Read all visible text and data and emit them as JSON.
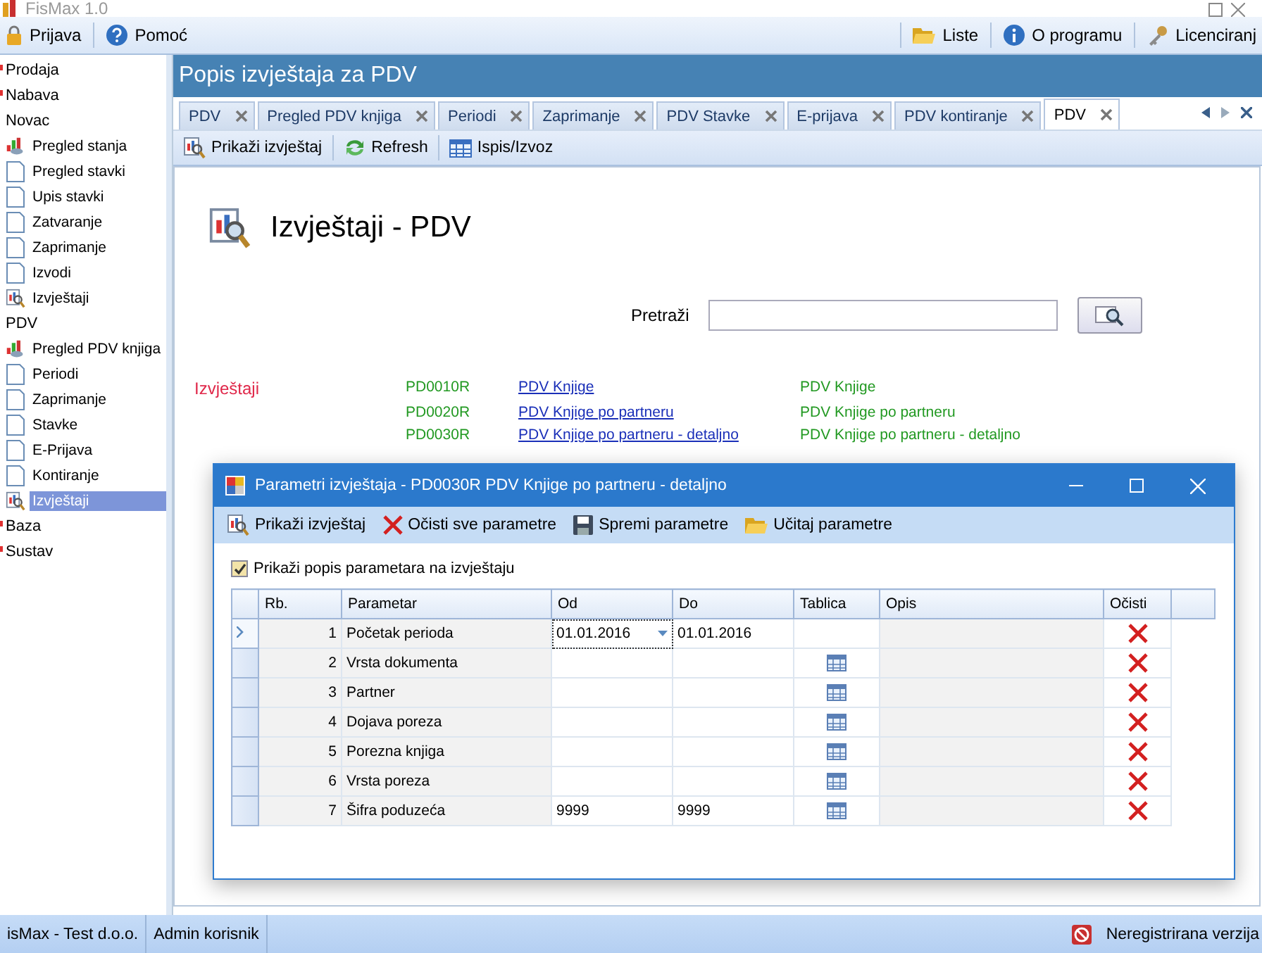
{
  "window": {
    "title": "FisMax 1.0"
  },
  "menubar": {
    "left": [
      {
        "label": "Prijava",
        "kind": "lock"
      },
      {
        "label": "Pomoć",
        "kind": "help"
      }
    ],
    "right": [
      {
        "label": "Liste",
        "kind": "folder"
      },
      {
        "label": "O programu",
        "kind": "info"
      },
      {
        "label": "Licenciranj",
        "kind": "keys"
      }
    ]
  },
  "sidebar": {
    "items": [
      {
        "label": "Prodaja",
        "expanded": false
      },
      {
        "label": "Nabava",
        "expanded": false
      },
      {
        "label": "Novac",
        "expanded": true,
        "children": [
          {
            "label": "Pregled stanja",
            "kind": "chart",
            "selected": false
          },
          {
            "label": "Pregled stavki",
            "kind": "page",
            "selected": false
          },
          {
            "label": "Upis stavki",
            "kind": "page",
            "selected": false
          },
          {
            "label": "Zatvaranje",
            "kind": "page",
            "selected": false
          },
          {
            "label": "Zaprimanje",
            "kind": "page",
            "selected": false
          },
          {
            "label": "Izvodi",
            "kind": "page",
            "selected": false
          },
          {
            "label": "Izvještaji",
            "kind": "report",
            "selected": false
          }
        ]
      },
      {
        "label": "PDV",
        "expanded": true,
        "children": [
          {
            "label": "Pregled PDV knjiga",
            "kind": "chart",
            "selected": false
          },
          {
            "label": "Periodi",
            "kind": "page",
            "selected": false
          },
          {
            "label": "Zaprimanje",
            "kind": "page",
            "selected": false
          },
          {
            "label": "Stavke",
            "kind": "page",
            "selected": false
          },
          {
            "label": "E-Prijava",
            "kind": "page",
            "selected": false
          },
          {
            "label": "Kontiranje",
            "kind": "page",
            "selected": false
          },
          {
            "label": "Izvještaji",
            "kind": "report",
            "selected": true
          }
        ]
      },
      {
        "label": "Baza",
        "expanded": false
      },
      {
        "label": "Sustav",
        "expanded": false
      }
    ]
  },
  "panel": {
    "title": "Popis izvještaja za PDV"
  },
  "tabs": [
    {
      "label": "PDV",
      "selected": false
    },
    {
      "label": "Pregled PDV knjiga",
      "selected": false
    },
    {
      "label": "Periodi",
      "selected": false
    },
    {
      "label": "Zaprimanje",
      "selected": false
    },
    {
      "label": "PDV Stavke",
      "selected": false
    },
    {
      "label": "E-prijava",
      "selected": false
    },
    {
      "label": "PDV kontiranje",
      "selected": false
    },
    {
      "label": "PDV",
      "selected": true
    }
  ],
  "toolbar": [
    {
      "label": "Prikaži izvještaj",
      "kind": "report"
    },
    {
      "label": "Refresh",
      "kind": "refresh"
    },
    {
      "label": "Ispis/Izvoz",
      "kind": "table"
    }
  ],
  "heading": "Izvještaji - PDV",
  "search": {
    "label": "Pretraži"
  },
  "reports": {
    "section": "Izvještaji",
    "rows": [
      {
        "code": "PD0010R",
        "link": "PDV Knjige",
        "description": "PDV Knjige"
      },
      {
        "code": "PD0020R",
        "link": "PDV Knjige po partneru",
        "description": "PDV Knjige po partneru"
      },
      {
        "code": "PD0030R",
        "link": "PDV Knjige po partneru - detaljno",
        "description": "PDV Knjige po partneru - detaljno"
      }
    ]
  },
  "dialog": {
    "title": "Parametri izvještaja - PD0030R PDV Knjige po partneru - detaljno",
    "toolbar": [
      {
        "label": "Prikaži izvještaj",
        "kind": "report"
      },
      {
        "label": "Očisti sve parametre",
        "kind": "clear"
      },
      {
        "label": "Spremi parametre",
        "kind": "save"
      },
      {
        "label": "Učitaj parametre",
        "kind": "folder"
      }
    ],
    "show_list": {
      "label": "Prikaži popis parametara na izvještaju",
      "checked": true
    },
    "columns": [
      "Rb.",
      "Parametar",
      "Od",
      "Do",
      "Tablica",
      "Opis",
      "Očisti"
    ],
    "rows": [
      {
        "rb": "1",
        "parametar": "Početak perioda",
        "od": "01.01.2016",
        "do": "01.01.2016",
        "has_table": false,
        "selected": true
      },
      {
        "rb": "2",
        "parametar": "Vrsta dokumenta",
        "od": "",
        "do": "",
        "has_table": true,
        "selected": false
      },
      {
        "rb": "3",
        "parametar": "Partner",
        "od": "",
        "do": "",
        "has_table": true,
        "selected": false
      },
      {
        "rb": "4",
        "parametar": "Dojava poreza",
        "od": "",
        "do": "",
        "has_table": true,
        "selected": false
      },
      {
        "rb": "5",
        "parametar": "Porezna knjiga",
        "od": "",
        "do": "",
        "has_table": true,
        "selected": false
      },
      {
        "rb": "6",
        "parametar": "Vrsta poreza",
        "od": "",
        "do": "",
        "has_table": true,
        "selected": false
      },
      {
        "rb": "7",
        "parametar": "Šifra poduzeća",
        "od": "9999",
        "do": "9999",
        "has_table": true,
        "selected": false
      }
    ]
  },
  "status_bar": {
    "left": [
      "isMax - Test d.o.o.",
      "Admin korisnik"
    ],
    "right": "Neregistrirana verzija"
  }
}
